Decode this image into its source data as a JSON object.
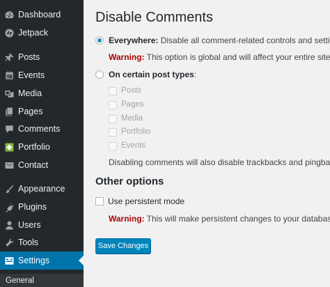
{
  "sidebar": {
    "items": [
      {
        "label": "Dashboard",
        "icon": "dashboard-icon"
      },
      {
        "label": "Jetpack",
        "icon": "jetpack-icon"
      },
      {
        "label": "Posts",
        "icon": "pin-icon"
      },
      {
        "label": "Events",
        "icon": "calendar-icon"
      },
      {
        "label": "Media",
        "icon": "media-icon"
      },
      {
        "label": "Pages",
        "icon": "pages-icon"
      },
      {
        "label": "Comments",
        "icon": "comment-icon"
      },
      {
        "label": "Portfolio",
        "icon": "portfolio-icon"
      },
      {
        "label": "Contact",
        "icon": "mail-icon"
      },
      {
        "label": "Appearance",
        "icon": "brush-icon"
      },
      {
        "label": "Plugins",
        "icon": "plug-icon"
      },
      {
        "label": "Users",
        "icon": "user-icon"
      },
      {
        "label": "Tools",
        "icon": "wrench-icon"
      },
      {
        "label": "Settings",
        "icon": "settings-icon"
      }
    ],
    "current": "Settings",
    "submenu_first": "General"
  },
  "page": {
    "title": "Disable Comments",
    "everywhere_label": "Everywhere:",
    "everywhere_desc": " Disable all comment-related controls and settings in WordPress.",
    "warning_label": "Warning:",
    "everywhere_warning": " This option is global and will affect your entire site. Use it only if you want to disable comments everywhere.",
    "post_types_label": "On certain post types",
    "post_types_colon": ":",
    "post_types": [
      "Posts",
      "Pages",
      "Media",
      "Portfolio",
      "Events"
    ],
    "post_types_note": "Disabling comments will also disable trackbacks and pingbacks. All comment-related fields will also be hidden from the edit/quick-edit screens of the affected posts.",
    "other_heading": "Other options",
    "persistent_label": "Use persistent mode",
    "persistent_warning": " This will make persistent changes to your database — comments will remain closed even if you later disable the plugin.",
    "save_label": "Save Changes"
  },
  "colors": {
    "sidebar_bg": "#23282d",
    "accent": "#0073aa",
    "warning": "#aa0000"
  }
}
